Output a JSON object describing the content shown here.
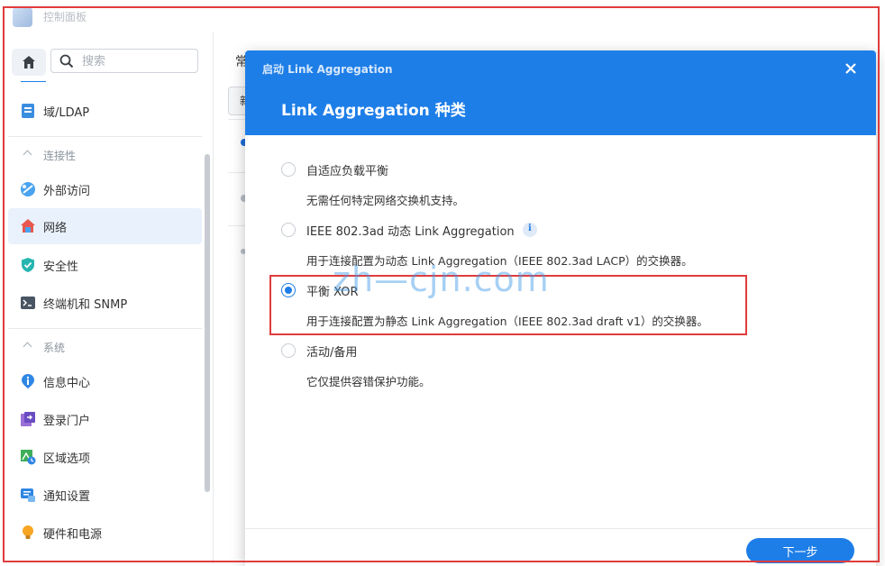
{
  "window": {
    "title": "控制面板"
  },
  "sidebar": {
    "search_placeholder": "搜索",
    "items": [
      {
        "label": "域/LDAP",
        "icon": "directory-icon"
      },
      {
        "section": "连接性"
      },
      {
        "label": "外部访问",
        "icon": "external-access-icon"
      },
      {
        "label": "网络",
        "icon": "network-house-icon",
        "active": true
      },
      {
        "label": "安全性",
        "icon": "security-shield-icon"
      },
      {
        "label": "终端机和 SNMP",
        "icon": "terminal-icon"
      },
      {
        "section": "系统"
      },
      {
        "label": "信息中心",
        "icon": "info-center-icon"
      },
      {
        "label": "登录门户",
        "icon": "login-portal-icon"
      },
      {
        "label": "区域选项",
        "icon": "region-options-icon"
      },
      {
        "label": "通知设置",
        "icon": "notification-icon"
      },
      {
        "label": "硬件和电源",
        "icon": "hardware-power-bulb-icon"
      }
    ]
  },
  "main": {
    "tab_peek": "常",
    "button_peek": "新"
  },
  "dialog": {
    "header_title": "启动 Link Aggregation",
    "subtitle": "Link Aggregation 种类",
    "options": [
      {
        "label": "自适应负载平衡",
        "description": "无需任何特定网络交换机支持。",
        "checked": false
      },
      {
        "label": "IEEE 802.3ad 动态 Link Aggregation",
        "description": "用于连接配置为动态 Link Aggregation（IEEE 802.3ad LACP）的交换器。",
        "checked": false,
        "info": "i"
      },
      {
        "label": "平衡 XOR",
        "description": "用于连接配置为静态 Link Aggregation（IEEE 802.3ad draft v1）的交换器。",
        "checked": true
      },
      {
        "label": "活动/备用",
        "description": "它仅提供容错保护功能。",
        "checked": false
      }
    ],
    "next_button": "下一步"
  },
  "watermark": "zh—cjn.com",
  "colors": {
    "accent": "#1e7ee8",
    "highlight": "#e03c3c"
  }
}
